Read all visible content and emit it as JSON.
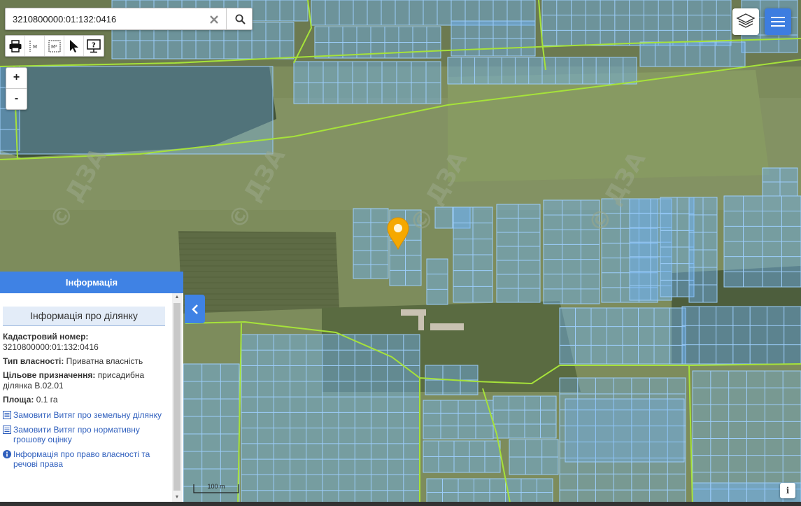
{
  "search": {
    "value": "3210800000:01:132:0416",
    "clear_icon": "close-icon",
    "search_icon": "search-icon"
  },
  "toolbar": {
    "tools": [
      {
        "icon": "printer-icon"
      },
      {
        "icon": "measure-distance-icon",
        "text": "M"
      },
      {
        "icon": "measure-area-icon",
        "text": "M²"
      },
      {
        "icon": "pointer-icon"
      },
      {
        "icon": "help-icon",
        "text": "?"
      }
    ]
  },
  "zoom": {
    "in_label": "+",
    "out_label": "-"
  },
  "controls": {
    "layers_icon": "layers-icon",
    "menu_icon": "hamburger-menu-icon"
  },
  "map": {
    "watermark": "© ДЗА",
    "scale_label": "100 m",
    "attribution_label": "i",
    "colors": {
      "parcel_fill": "#6fb2f5",
      "parcel_stroke": "#9ccdfa",
      "boundary": "#a6e23a",
      "marker": "#f5a800",
      "accent": "#3f82e4"
    }
  },
  "panel": {
    "header": "Інформація",
    "title": "Інформація про ділянку",
    "fields": [
      {
        "label": "Кадастровий номер:",
        "value": "3210800000:01:132:0416"
      },
      {
        "label": "Тип власності:",
        "value": "Приватна власність"
      },
      {
        "label": "Цільове призначення:",
        "value": "присадибна ділянка В.02.01"
      },
      {
        "label": "Площа:",
        "value": "0.1 га"
      }
    ],
    "links": [
      {
        "icon": "document-icon",
        "text": "Замовити Витяг про земельну ділянку"
      },
      {
        "icon": "document-icon",
        "text": "Замовити Витяг про нормативну грошову оцінку"
      },
      {
        "icon": "info-icon",
        "text": "Інформація про право власності та речові права"
      }
    ]
  }
}
